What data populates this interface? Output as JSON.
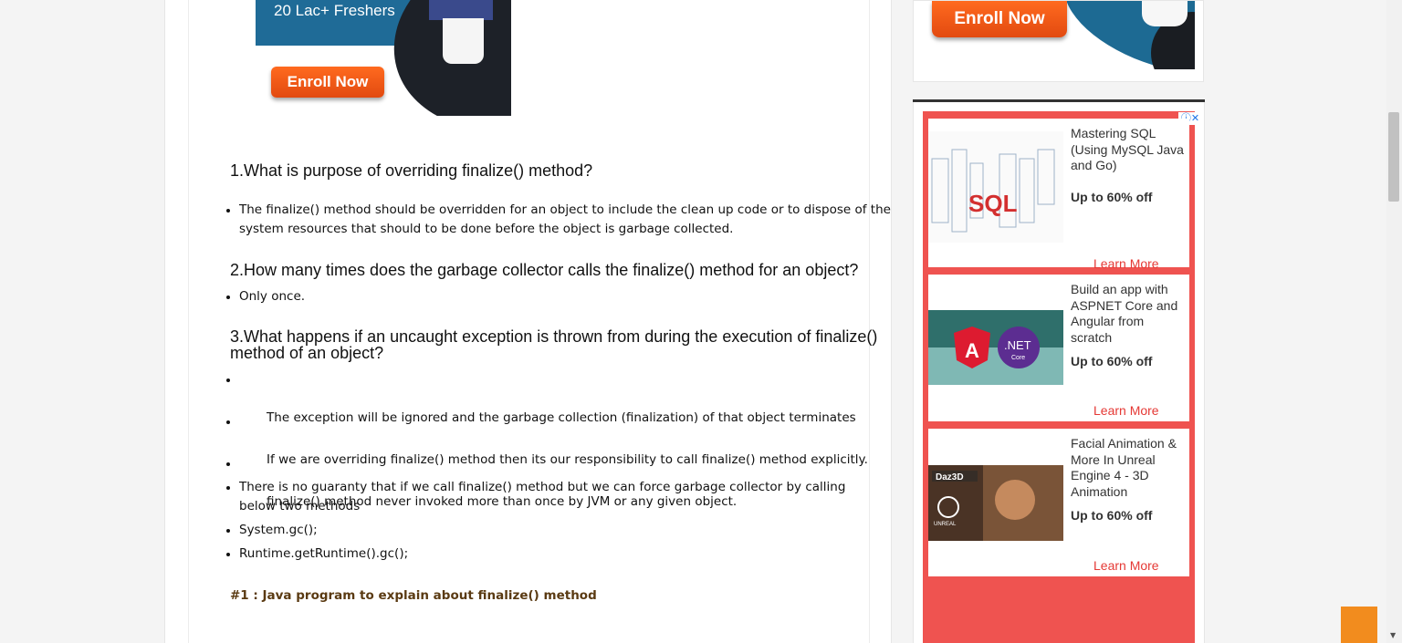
{
  "banner": {
    "tagline": "20 Lac+ Freshers",
    "cta": "Enroll Now"
  },
  "questions": [
    {
      "title": "1.What is purpose of overriding finalize() method?",
      "items": [
        "The finalize() method should be overridden for an object to include the clean up code or to dispose of the system resources that should to be done before the object is garbage collected."
      ]
    },
    {
      "title": "2.How many times does the garbage collector calls the finalize() method for an object?",
      "items": [
        "Only once."
      ]
    },
    {
      "title": "3.What happens if an uncaught exception is thrown from during the execution of finalize() method of  an object?",
      "items": [
        " The exception will be ignored and the garbage collection (finalization) of that object terminates",
        " If we are overriding finalize() method then its our responsibility to call finalize() method explicitly.",
        " finalize() method never invoked more than once by JVM or any given object.",
        "There is no guaranty that if we call finalize() method but we can force garbage collector by calling below two methods",
        "System.gc();",
        "Runtime.getRuntime().gc();"
      ]
    }
  ],
  "code_heading": "#1 : Java program to explain about finalize() method",
  "sidebar": {
    "top_ad_cta": "Enroll Now",
    "ad_info": "ⓘ✕",
    "cards": [
      {
        "title": "Mastering SQL (Using MySQL Java and Go)",
        "offer": "Up to 60% off",
        "cta": "Learn More",
        "thumb_text": "SQL"
      },
      {
        "title": "Build an app with ASPNET Core and Angular from scratch",
        "offer": "Up to 60% off",
        "cta": "Learn More",
        "thumb_text": ".NET",
        "thumb_subtext": "Core",
        "thumb_letter": "A"
      },
      {
        "title": "Facial Animation & More In Unreal Engine 4 - 3D Animation",
        "offer": "Up to 60% off",
        "cta": "Learn More",
        "thumb_text": "Daz3D",
        "thumb_subtext": "UNREAL"
      }
    ]
  },
  "colors": {
    "accent": "#ef5350",
    "cta": "#ff6a1f",
    "backtop": "#f28c1e"
  }
}
